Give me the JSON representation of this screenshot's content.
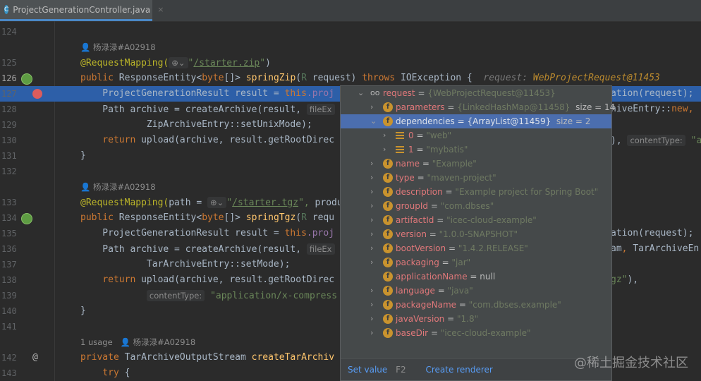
{
  "tab": {
    "title": "ProjectGenerationController.java",
    "icon": "C",
    "close": "×"
  },
  "rows": [
    {
      "ln": "124",
      "tokens": []
    },
    {
      "meta": "👤 杨渌渌#A02918"
    },
    {
      "ln": "125",
      "tokens": [
        [
          "@RequestMapping(",
          "a"
        ],
        [
          "⊕⌄",
          "h"
        ],
        [
          "\"",
          "s"
        ],
        [
          "/starter.zip",
          "u"
        ],
        [
          "\"",
          "s"
        ],
        [
          ")",
          "t"
        ]
      ]
    },
    {
      "ln": "126",
      "act": true,
      "icon": "web",
      "tokens": [
        [
          "public ",
          "k"
        ],
        [
          "ResponseEntity<",
          "t"
        ],
        [
          "byte",
          "k"
        ],
        [
          "[]> ",
          "t"
        ],
        [
          "springZip",
          "m"
        ],
        [
          "(",
          "t"
        ],
        [
          "R ",
          "p"
        ],
        [
          "request) ",
          "t"
        ],
        [
          "throws ",
          "k"
        ],
        [
          "IOException {  ",
          "t"
        ],
        [
          "request: ",
          "hi"
        ],
        [
          "WebProjectRequest@11453",
          "ho"
        ]
      ]
    },
    {
      "ln": "127",
      "cur": true,
      "icon": "bp",
      "tokens": [
        [
          "    ProjectGenerationResult result = ",
          "t"
        ],
        [
          "this",
          "k"
        ],
        [
          ".proj",
          "f"
        ]
      ],
      "right": [
        [
          "ation(request);",
          "t"
        ]
      ]
    },
    {
      "ln": "128",
      "tokens": [
        [
          "    Path archive = createArchive(result, ",
          "t"
        ],
        [
          "fileEx",
          "h"
        ]
      ],
      "right": [
        [
          "hiveEntry::",
          "t"
        ],
        [
          "new",
          "k"
        ],
        [
          ",",
          "k"
        ]
      ]
    },
    {
      "ln": "129",
      "tokens": [
        [
          "            ZipArchiveEntry::setUnixMode);",
          "t"
        ]
      ]
    },
    {
      "ln": "130",
      "tokens": [
        [
          "    ",
          "t"
        ],
        [
          "return ",
          "k"
        ],
        [
          "upload(archive, result.getRootDirec",
          "t"
        ]
      ],
      "right": [
        [
          "), ",
          "t"
        ],
        [
          "contentType:",
          "h"
        ],
        [
          " \"a",
          "s"
        ]
      ]
    },
    {
      "ln": "131",
      "tokens": [
        [
          "}",
          "t"
        ]
      ]
    },
    {
      "ln": "132",
      "tokens": []
    },
    {
      "meta": "👤 杨渌渌#A02918"
    },
    {
      "ln": "133",
      "tokens": [
        [
          "@RequestMapping(",
          "a"
        ],
        [
          "path = ",
          "t"
        ],
        [
          "⊕⌄",
          "h"
        ],
        [
          "\"",
          "s"
        ],
        [
          "/starter.tgz",
          "u"
        ],
        [
          "\", ",
          "s"
        ],
        [
          "produ",
          "t"
        ]
      ]
    },
    {
      "ln": "134",
      "icon": "web",
      "tokens": [
        [
          "public ",
          "k"
        ],
        [
          "ResponseEntity<",
          "t"
        ],
        [
          "byte",
          "k"
        ],
        [
          "[]> ",
          "t"
        ],
        [
          "springTgz",
          "m"
        ],
        [
          "(",
          "t"
        ],
        [
          "R ",
          "p"
        ],
        [
          "requ",
          "t"
        ]
      ]
    },
    {
      "ln": "135",
      "tokens": [
        [
          "    ProjectGenerationResult result = ",
          "t"
        ],
        [
          "this",
          "k"
        ],
        [
          ".proj",
          "f"
        ]
      ],
      "right": [
        [
          "ation(request);",
          "t"
        ]
      ]
    },
    {
      "ln": "136",
      "tokens": [
        [
          "    Path archive = createArchive(result, ",
          "t"
        ],
        [
          "fileEx",
          "h"
        ]
      ],
      "right": [
        [
          "am",
          "t"
        ],
        [
          ", ",
          "k"
        ],
        [
          "TarArchiveEn",
          "t"
        ]
      ]
    },
    {
      "ln": "137",
      "tokens": [
        [
          "            TarArchiveEntry::setMode);",
          "t"
        ]
      ]
    },
    {
      "ln": "138",
      "tokens": [
        [
          "    ",
          "t"
        ],
        [
          "return ",
          "k"
        ],
        [
          "upload(archive, result.getRootDirec",
          "t"
        ]
      ],
      "right": [
        [
          "gz\"",
          "s"
        ],
        [
          "),",
          "t"
        ]
      ]
    },
    {
      "ln": "139",
      "tokens": [
        [
          "            ",
          "t"
        ],
        [
          "contentType:",
          "h"
        ],
        [
          " \"application/x-compress",
          "s"
        ]
      ]
    },
    {
      "ln": "140",
      "tokens": [
        [
          "}",
          "t"
        ]
      ]
    },
    {
      "ln": "141",
      "tokens": []
    },
    {
      "meta": "1 usage   👤 杨渌渌#A02918"
    },
    {
      "ln": "142",
      "icon": "at",
      "tokens": [
        [
          "private ",
          "k"
        ],
        [
          "TarArchiveOutputStream ",
          "t"
        ],
        [
          "createTarArchiv",
          "m"
        ]
      ]
    },
    {
      "ln": "143",
      "tokens": [
        [
          "    ",
          "t"
        ],
        [
          "try ",
          "k"
        ],
        [
          "{",
          "t"
        ]
      ]
    }
  ],
  "popup": {
    "rows": [
      {
        "level": 0,
        "chev": "⌄",
        "icon": "watch",
        "name": "request",
        "eq": " = ",
        "val": "{WebProjectRequest@11453}"
      },
      {
        "level": 1,
        "chev": "›",
        "icon": "f",
        "name": "parameters",
        "eq": " = ",
        "val": "{LinkedHashMap@11458}",
        "extra": "  size = 14"
      },
      {
        "level": 1,
        "chev": "⌄",
        "icon": "f",
        "name": "dependencies",
        "eq": " = ",
        "val": "{ArrayList@11459}",
        "extra": "  size = 2",
        "sel": true
      },
      {
        "level": 2,
        "chev": "›",
        "icon": "list",
        "name": "0",
        "eq": " = ",
        "val": "\"web\""
      },
      {
        "level": 2,
        "chev": "›",
        "icon": "list",
        "name": "1",
        "eq": " = ",
        "val": "\"mybatis\""
      },
      {
        "level": 1,
        "chev": "›",
        "icon": "f",
        "name": "name",
        "eq": " = ",
        "val": "\"Example\""
      },
      {
        "level": 1,
        "chev": "›",
        "icon": "f",
        "name": "type",
        "eq": " = ",
        "val": "\"maven-project\""
      },
      {
        "level": 1,
        "chev": "›",
        "icon": "f",
        "name": "description",
        "eq": " = ",
        "val": "\"Example project for Spring Boot\""
      },
      {
        "level": 1,
        "chev": "›",
        "icon": "f",
        "name": "groupId",
        "eq": " = ",
        "val": "\"com.dbses\""
      },
      {
        "level": 1,
        "chev": "›",
        "icon": "f",
        "name": "artifactId",
        "eq": " = ",
        "val": "\"icec-cloud-example\""
      },
      {
        "level": 1,
        "chev": "›",
        "icon": "f",
        "name": "version",
        "eq": " = ",
        "val": "\"1.0.0-SNAPSHOT\""
      },
      {
        "level": 1,
        "chev": "›",
        "icon": "f",
        "name": "bootVersion",
        "eq": " = ",
        "val": "\"1.4.2.RELEASE\""
      },
      {
        "level": 1,
        "chev": "›",
        "icon": "f",
        "name": "packaging",
        "eq": " = ",
        "val": "\"jar\""
      },
      {
        "level": 1,
        "chev": "",
        "icon": "f",
        "name": "applicationName",
        "eq": " = ",
        "val": "null",
        "plain": true
      },
      {
        "level": 1,
        "chev": "›",
        "icon": "f",
        "name": "language",
        "eq": " = ",
        "val": "\"java\""
      },
      {
        "level": 1,
        "chev": "›",
        "icon": "f",
        "name": "packageName",
        "eq": " = ",
        "val": "\"com.dbses.example\""
      },
      {
        "level": 1,
        "chev": "›",
        "icon": "f",
        "name": "javaVersion",
        "eq": " = ",
        "val": "\"1.8\""
      },
      {
        "level": 1,
        "chev": "›",
        "icon": "f",
        "name": "baseDir",
        "eq": " = ",
        "val": "\"icec-cloud-example\""
      }
    ],
    "footer": {
      "set_value": "Set value",
      "set_value_key": "F2",
      "create_renderer": "Create renderer"
    }
  },
  "watermark": "@稀土掘金技术社区"
}
